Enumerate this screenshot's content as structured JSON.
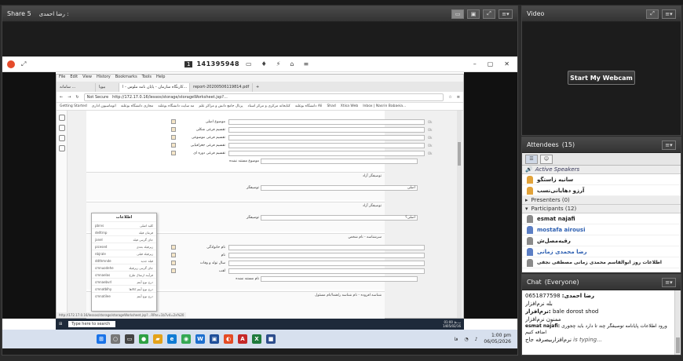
{
  "share_pod": {
    "title": "Share 5",
    "presenter": "رضا احمدی :",
    "menu_icon": "≡▾"
  },
  "remote_bar": {
    "session_num": "1",
    "session_id": "141395948",
    "tools": [
      "▭",
      "♦",
      "⚡",
      "⌂",
      "≡",
      "⌂"
    ],
    "win_controls": [
      "–",
      "▢",
      "✕"
    ]
  },
  "browser": {
    "menu": [
      "File",
      "Edit",
      "View",
      "History",
      "Bookmarks",
      "Tools",
      "Help"
    ],
    "tabs": [
      "سامانه ...",
      "بیوپا",
      "کارنگاه سازمان - پایان نامه ملوس - ا...",
      "report-20200506119814.pdf",
      "+"
    ],
    "not_secure": "Not Secure",
    "url": "http://172.17.0.16/lessos/storage/storageWorksheet.jsp?...",
    "bookmarks": [
      "Getting Started",
      "اتوماسیون اداری",
      "مجازی دانشگاه بوعلند",
      "مه سایت دانشگاه بوعلند",
      "پرتال جامع دانش و مراکز علم",
      "کتابخانه مرکزی و مرکز اسناد",
      "دانشگاه بوعلند Ali",
      "Shad",
      "Xtisa Web",
      "Inbox | Nasrin Babaeia..."
    ],
    "section1": {
      "rows": [
        {
          "label": "موضوع اصلی",
          "fmt": "Ok"
        },
        {
          "label": "تقسیم فرعی شکلی",
          "fmt": "Ok"
        },
        {
          "label": "تقسیم فرعی موضوعی",
          "fmt": "Ok"
        },
        {
          "label": "تقسیم فرعی جغرافیایی",
          "fmt": "Ok"
        },
        {
          "label": "تقسیم فرعی دوره ای",
          "fmt": "Ok"
        }
      ],
      "plain_row": "موضوع مستند نشده"
    },
    "section2": {
      "header": "توصیفگر آزاد",
      "row_label": "توصیفگر",
      "row_value": "اصلی"
    },
    "section3": {
      "header": "توصیفگر آزاد",
      "row_label": "توصیفگر",
      "row_value": "اصلی؟"
    },
    "section4": {
      "header": "سرشناسه - نام شخص",
      "rows": [
        {
          "label": "نام خانوادگی"
        },
        {
          "label": "نام"
        },
        {
          "label": "سال تولد و وفات"
        },
        {
          "label": "لقب"
        },
        {
          "label": "نام مستند نشده"
        }
      ]
    },
    "section5": {
      "header": "شناسه افزوده - نام شناسه راهنما/نام مسئول"
    },
    "popup": {
      "title": "اطلاعات",
      "items": [
        [
          "‎pbrvs",
          "کلید اصلی"
        ],
        [
          "‎delltrnp",
          "فرمان فیلد"
        ],
        [
          "‎janel",
          "جای گزینی فیلد"
        ],
        [
          "‎picesed",
          "زیرفیلد بعدی"
        ],
        [
          "‎nbjrale",
          "زیرفیلد قبلی"
        ],
        [
          "‎ddthmnde",
          "فیلد جدید"
        ],
        [
          "‎cmnuodehe",
          "جای گزینی زیرفیلد"
        ],
        [
          "‎cmnaelas",
          "فرآیند ارسال طرح"
        ],
        [
          "‎cmnaebvrl",
          "درج نوع آیتم"
        ],
        [
          "‎cmnatblhy",
          "درج نوع آیتم کالاها"
        ],
        [
          "‎cmnatilee",
          "درج نوع آیتم"
        ]
      ]
    },
    "status_url": "http://172.17.0.16/lessos/storage/storageWorksheet.jsp?...RPar=1b7v4=2x%20"
  },
  "remote_taskbar": {
    "search": "Type here to search",
    "clock_time": "01:00 ب.ظ",
    "clock_date": "1405/02/16"
  },
  "taskbar": {
    "time": "1:00 pm",
    "date": "06/05/2026"
  },
  "video_pod": {
    "title": "Video",
    "webcam_button": "Start My Webcam"
  },
  "attendees": {
    "title": "Attendees",
    "count": "(15)",
    "active_speakers": "Active Speakers",
    "active": [
      "سانیه زاستگو",
      "آرزو دهایانی‌نسب"
    ],
    "presenters": "Presenters (0)",
    "participants": "Participants (12)",
    "list": [
      {
        "name": "esmat najafi",
        "style": "bold"
      },
      {
        "name": "mostafa airousi",
        "style": "blue"
      },
      {
        "name": "رقیه‌مصل‌ش",
        "style": "bold"
      },
      {
        "name": "رضا محمدی زمانی",
        "style": "blue"
      },
      {
        "name": "اطلاعات روز ابوالقاسم محمدی زمانی مصطفی نجفی",
        "style": "bold"
      }
    ]
  },
  "chat": {
    "title": "Chat",
    "scope": "(Everyone)",
    "lines": [
      {
        "sender": "رضا احمدی:",
        "text": "0651877598"
      },
      {
        "sender": "",
        "text": "بله نرم‌افزار"
      },
      {
        "sender": "نرم‌افزار:",
        "text": "bale dorost shod"
      },
      {
        "sender": "",
        "text": "ممنون نرم‌افزار"
      },
      {
        "sender": "esmat najafi:",
        "text": "ورود اطلاعات پایانامه توصیفگر چند تا دارد باید چجوری اضافه کنیم"
      },
      {
        "sender": "",
        "text": "نرم‌افزار‌بیصرفه جاج"
      }
    ],
    "typing": "is typing..."
  },
  "colors": {
    "accent": "#2a5db0",
    "header_dark": "#333333",
    "taskbar": "#d7e0ee"
  }
}
